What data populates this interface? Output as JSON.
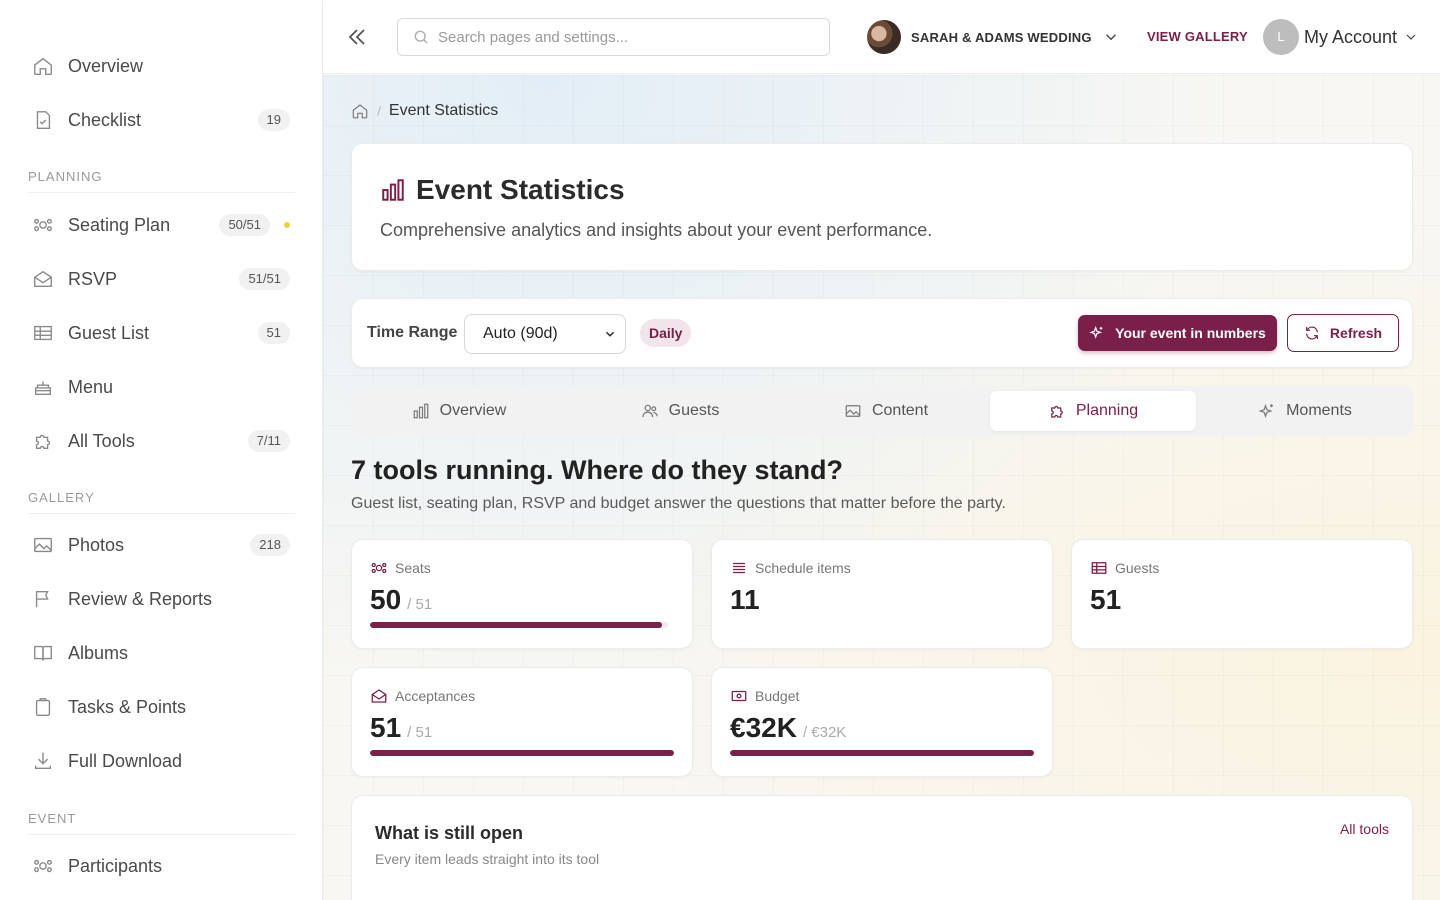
{
  "sidebar": {
    "items": [
      {
        "label": "Overview",
        "icon": "home-icon"
      },
      {
        "label": "Checklist",
        "icon": "checklist-icon",
        "count": "19"
      }
    ],
    "sections": {
      "planning": "PLANNING",
      "gallery": "GALLERY",
      "event": "EVENT"
    },
    "planning_items": [
      {
        "label": "Seating Plan",
        "icon": "seating-icon",
        "count": "50/51"
      },
      {
        "label": "RSVP",
        "icon": "envelope-icon",
        "count": "51/51"
      },
      {
        "label": "Guest List",
        "icon": "table-icon",
        "count": "51"
      },
      {
        "label": "Menu",
        "icon": "cake-icon"
      },
      {
        "label": "All Tools",
        "icon": "puzzle-icon",
        "count": "7/11"
      }
    ],
    "gallery_items": [
      {
        "label": "Photos",
        "icon": "image-icon",
        "count": "218"
      },
      {
        "label": "Review & Reports",
        "icon": "flag-icon"
      },
      {
        "label": "Albums",
        "icon": "book-icon"
      },
      {
        "label": "Tasks & Points",
        "icon": "clipboard-icon"
      },
      {
        "label": "Full Download",
        "icon": "download-icon"
      }
    ],
    "event_items": [
      {
        "label": "Participants",
        "icon": "people-icon"
      }
    ],
    "status_dot_color": "#f2d23a"
  },
  "header": {
    "search_placeholder": "Search pages and settings...",
    "event_name": "SARAH & ADAMS WEDDING",
    "view_gallery": "VIEW GALLERY",
    "account_initial": "L",
    "account_label": "My Account"
  },
  "breadcrumb": {
    "current": "Event Statistics"
  },
  "page": {
    "title": "Event Statistics",
    "subtitle": "Comprehensive analytics and insights about your event performance."
  },
  "controls": {
    "time_range_label": "Time Range",
    "time_range_value": "Auto (90d)",
    "granularity_badge": "Daily",
    "primary_button": "Your event in numbers",
    "refresh_button": "Refresh"
  },
  "tabs": [
    {
      "label": "Overview",
      "icon": "bar-chart-icon",
      "active": false
    },
    {
      "label": "Guests",
      "icon": "people-icon",
      "active": false
    },
    {
      "label": "Content",
      "icon": "image-icon",
      "active": false
    },
    {
      "label": "Planning",
      "icon": "puzzle-icon",
      "active": true
    },
    {
      "label": "Moments",
      "icon": "sparkles-icon",
      "active": false
    }
  ],
  "planning": {
    "headline": "7 tools running. Where do they stand?",
    "subline": "Guest list, seating plan, RSVP and budget answer the questions that matter before the party.",
    "stats": [
      {
        "label": "Seats",
        "icon": "seating-icon",
        "value": "50",
        "total": "/ 51",
        "progress": 0.98
      },
      {
        "label": "Schedule items",
        "icon": "list-icon",
        "value": "11"
      },
      {
        "label": "Guests",
        "icon": "table-icon",
        "value": "51"
      },
      {
        "label": "Acceptances",
        "icon": "envelope-icon",
        "value": "51",
        "total": "/ 51",
        "progress": 1.0
      },
      {
        "label": "Budget",
        "icon": "money-icon",
        "value": "€32K",
        "total": "/ €32K",
        "progress": 1.0
      }
    ],
    "open": {
      "title": "What is still open",
      "subtitle": "Every item leads straight into its tool",
      "link": "All tools"
    }
  },
  "colors": {
    "accent": "#7a1e4a",
    "accent_soft": "#f1e4ea"
  }
}
